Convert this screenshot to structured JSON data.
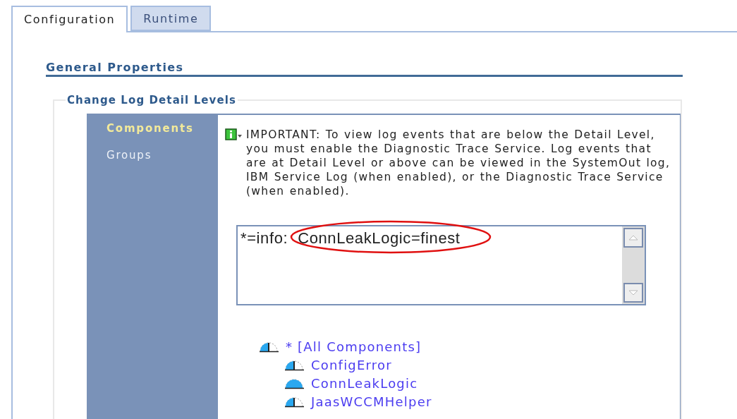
{
  "tabs": [
    {
      "label": "Configuration",
      "selected": true
    },
    {
      "label": "Runtime",
      "selected": false
    }
  ],
  "section_title": "General Properties",
  "fieldset": {
    "legend": "Change Log Detail Levels",
    "nav": [
      {
        "label": "Components",
        "selected": true
      },
      {
        "label": "Groups",
        "selected": false
      }
    ],
    "notice": "IMPORTANT: To view log events that are below the Detail Level, you must enable the Diagnostic Trace Service. Log events that are at Detail Level or above can be viewed in the SystemOut log, IBM Service Log (when enabled), or the Diagnostic Trace Service (when enabled).",
    "spec_prefix": "*=info:",
    "spec_highlighted": "ConnLeakLogic=finest",
    "tree": [
      {
        "label": "* [All Components]",
        "kind": "partial",
        "children": [
          {
            "label": "ConfigError",
            "kind": "partial"
          },
          {
            "label": "ConnLeakLogic",
            "kind": "full"
          },
          {
            "label": "JaasWCCMHelper",
            "kind": "partial"
          }
        ]
      }
    ]
  }
}
